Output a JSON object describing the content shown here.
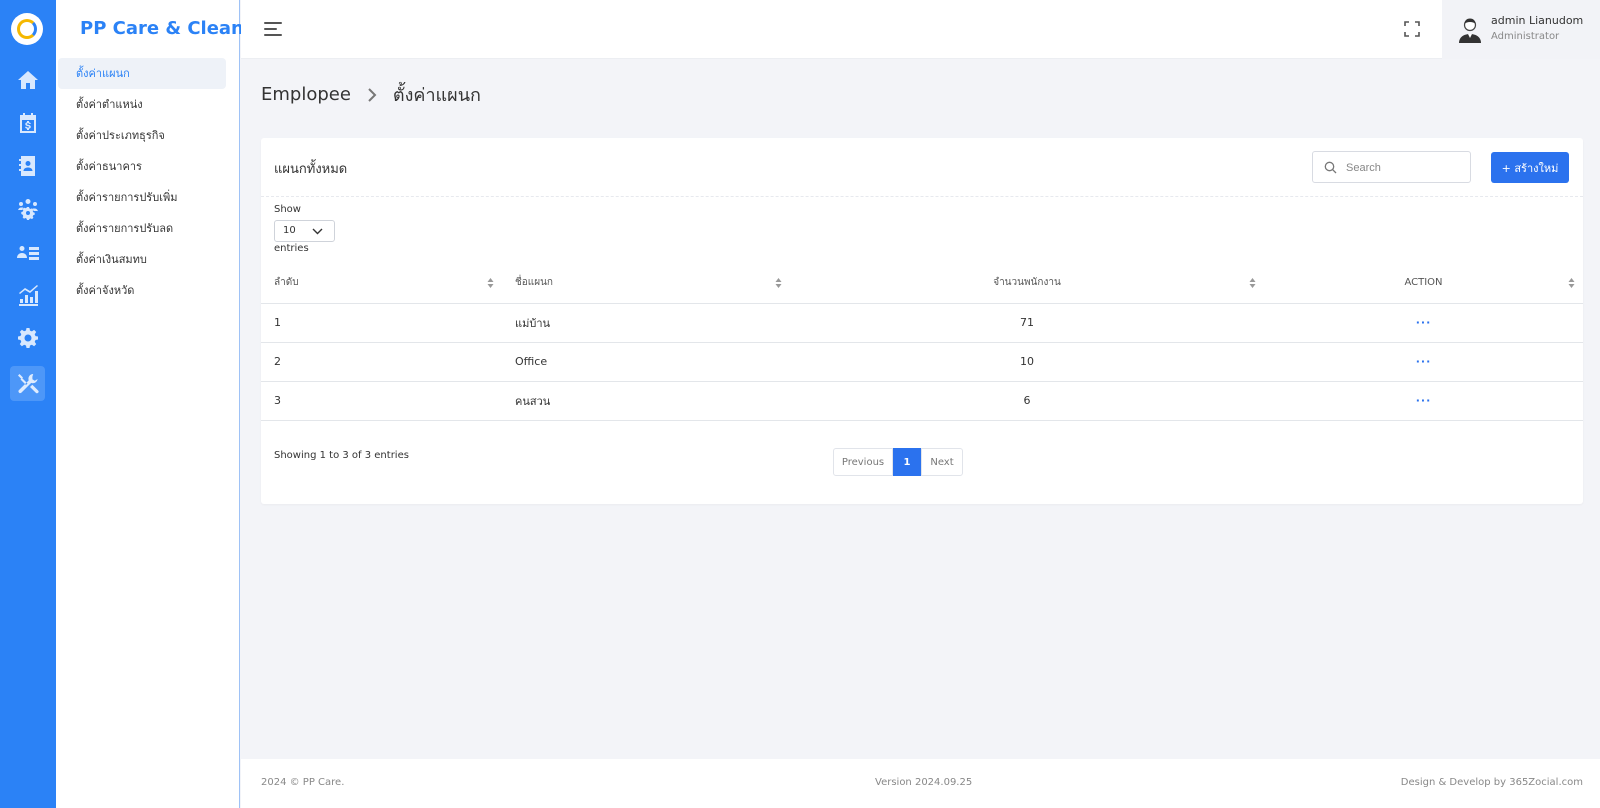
{
  "brand": "PP Care & Clean",
  "rail": {
    "items": [
      {
        "icon": "home-icon"
      },
      {
        "icon": "calendar-dollar-icon"
      },
      {
        "icon": "contact-book-icon"
      },
      {
        "icon": "team-gear-icon"
      },
      {
        "icon": "user-list-icon"
      },
      {
        "icon": "chart-icon"
      },
      {
        "icon": "gear-icon"
      },
      {
        "icon": "tools-icon",
        "active": true
      }
    ]
  },
  "submenu": {
    "items": [
      {
        "label": "ตั้งค่าแผนก",
        "active": true
      },
      {
        "label": "ตั้งค่าตำแหน่ง"
      },
      {
        "label": "ตั้งค่าประเภทธุรกิจ"
      },
      {
        "label": "ตั้งค่าธนาคาร"
      },
      {
        "label": "ตั้งค่ารายการปรับเพิ่ม"
      },
      {
        "label": "ตั้งค่ารายการปรับลด"
      },
      {
        "label": "ตั้งค่าเงินสมทบ"
      },
      {
        "label": "ตั้งค่าจังหวัด"
      }
    ]
  },
  "header": {
    "user_name": "admin Lianudom",
    "user_role": "Administrator"
  },
  "breadcrumb": {
    "parent": "Emplopee",
    "current": "ตั้งค่าแผนก"
  },
  "card": {
    "title": "แผนกทั้งหมด",
    "search_placeholder": "Search",
    "create_label": "+ สร้างใหม่",
    "show_label": "Show",
    "page_length": "10",
    "entries_label": "entries",
    "columns": [
      "ลำดับ",
      "ชื่อแผนก",
      "จำนวนพนักงาน",
      "ACTION"
    ],
    "rows": [
      {
        "no": "1",
        "name": "แม่บ้าน",
        "count": "71",
        "action": "···"
      },
      {
        "no": "2",
        "name": "Office",
        "count": "10",
        "action": "···"
      },
      {
        "no": "3",
        "name": "คนสวน",
        "count": "6",
        "action": "···"
      }
    ],
    "info": "Showing 1 to 3 of 3 entries",
    "pager": {
      "prev": "Previous",
      "page": "1",
      "next": "Next"
    }
  },
  "footer": {
    "copyright": "2024 © PP Care.",
    "version": "Version 2024.09.25",
    "credit": "Design & Develop by 365Zocial.com"
  },
  "colors": {
    "primary": "#2b82f6",
    "button": "#2b72ee",
    "background": "#f3f4f8"
  }
}
